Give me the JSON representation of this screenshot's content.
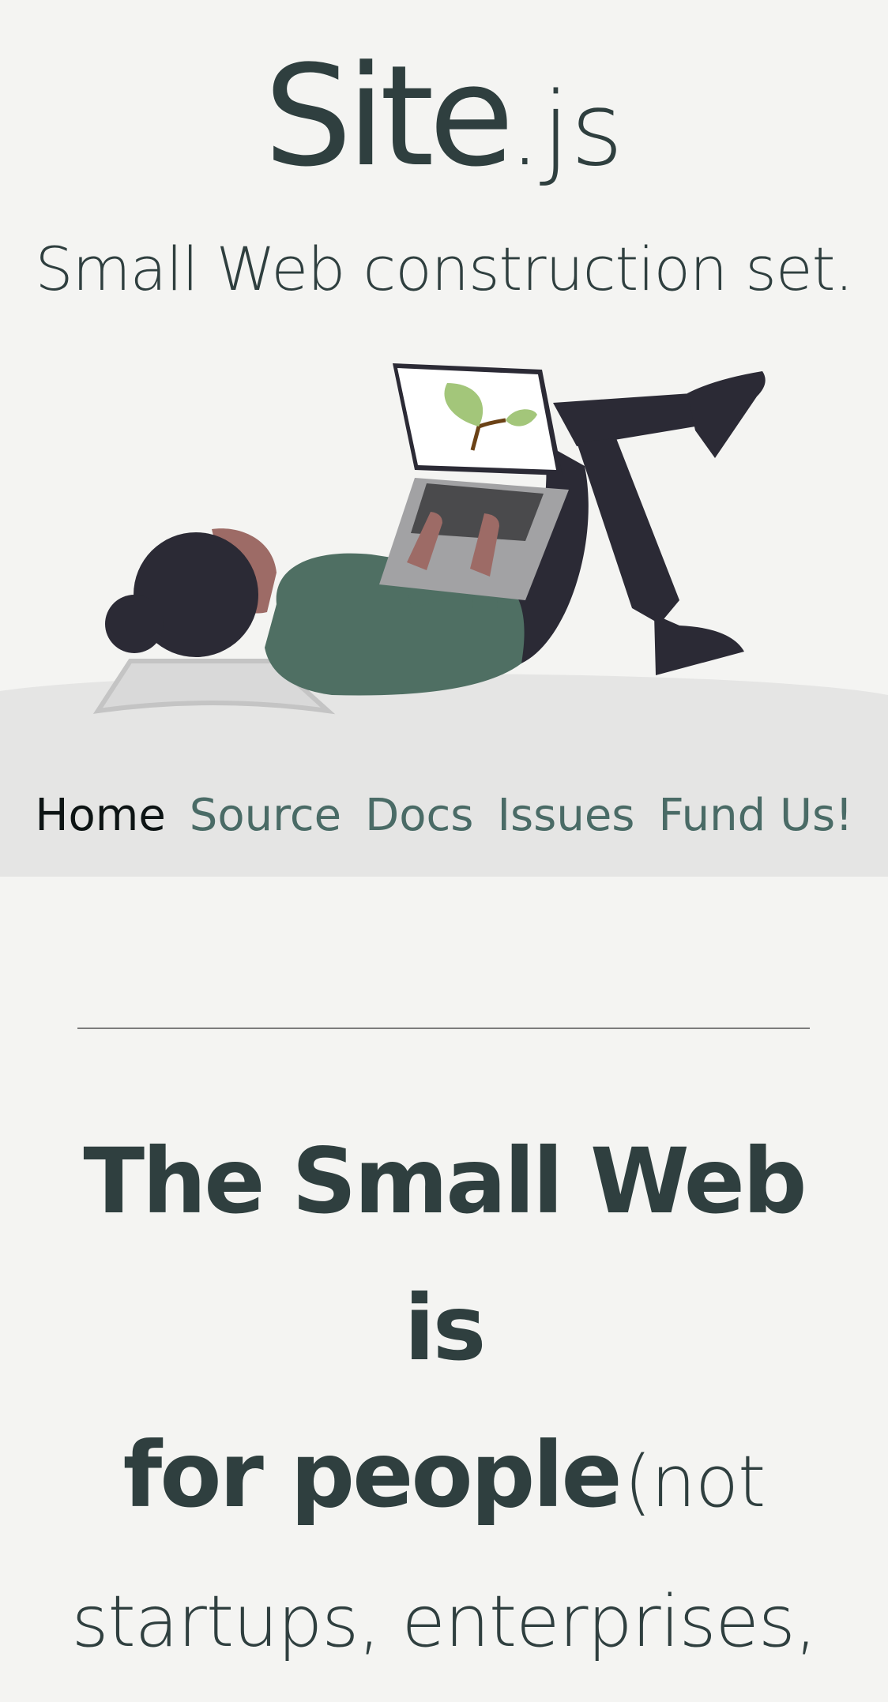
{
  "site": {
    "name_main": "Site",
    "name_ext": ".js",
    "tagline": "Small Web construction set."
  },
  "nav": {
    "items": [
      {
        "label": "Home",
        "current": true
      },
      {
        "label": "Source",
        "current": false
      },
      {
        "label": "Docs",
        "current": false
      },
      {
        "label": "Issues",
        "current": false
      },
      {
        "label": "Fund Us!",
        "current": false
      }
    ]
  },
  "headline": {
    "strong_line1": "The Small Web is",
    "strong_line2": "for people",
    "light_part": "(not startups, enterprises,"
  },
  "illustration": {
    "icon": "person-lying-with-laptop-illustration",
    "colors": {
      "hair": "#2b2a35",
      "skin": "#9d6b66",
      "sweater": "#4f6f63",
      "pants": "#2b2a35",
      "laptop": "#a2a2a4",
      "screen": "#ffffff",
      "leaf": "#a3c67a",
      "pillow": "#d9d9d9"
    }
  },
  "theme": {
    "background": "#f4f4f2",
    "band": "#e5e5e4",
    "text": "#2f3f3f",
    "link": "#4a6b66",
    "link_current": "#0d1414"
  }
}
